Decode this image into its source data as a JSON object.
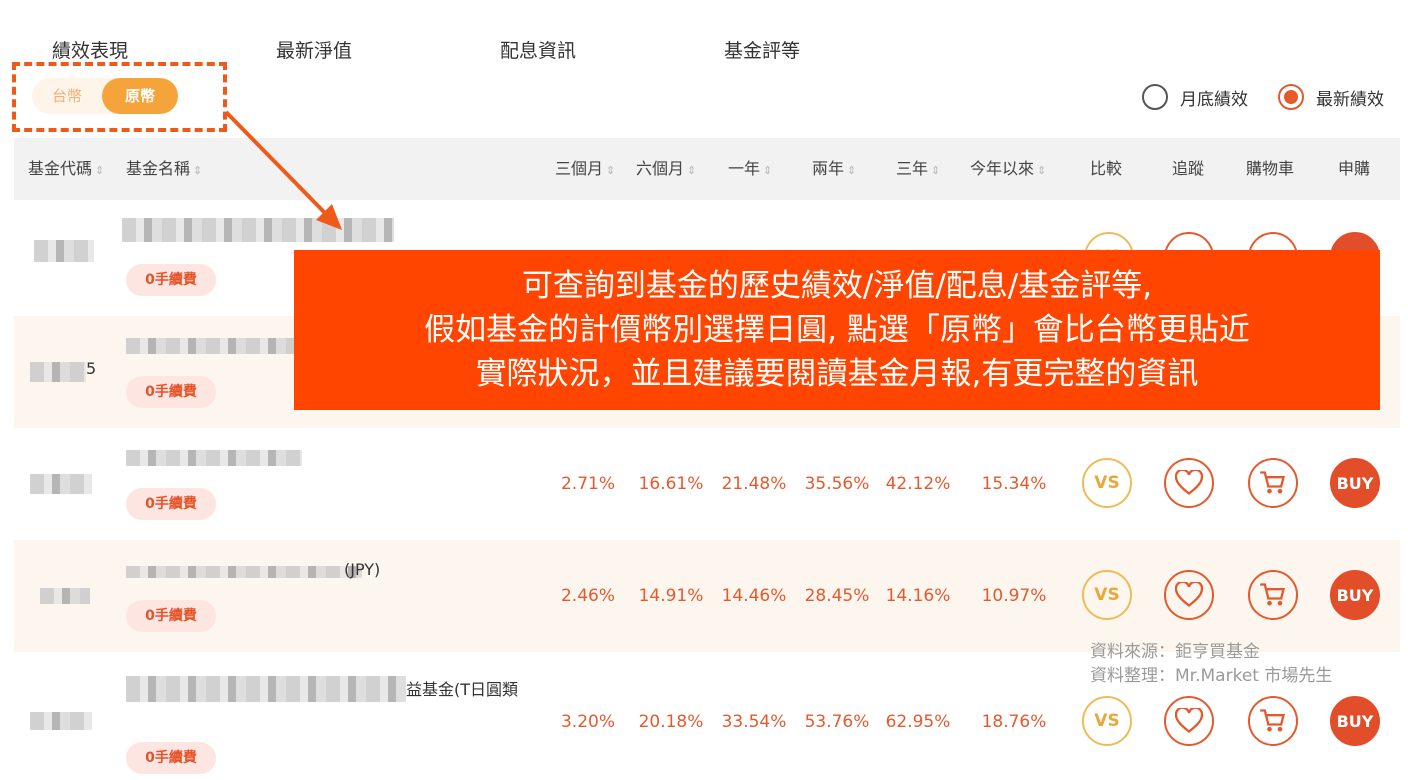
{
  "tabs": [
    "績效表現",
    "最新淨值",
    "配息資訊",
    "基金評等"
  ],
  "currency": {
    "twd": "台幣",
    "original": "原幣",
    "selected": "原幣"
  },
  "radios": {
    "month_end": "月底績效",
    "latest": "最新績效",
    "selected": "最新績效"
  },
  "table": {
    "headers": {
      "code": "基金代碼",
      "name": "基金名稱",
      "m3": "三個月",
      "m6": "六個月",
      "y1": "一年",
      "y2": "兩年",
      "y3": "三年",
      "ytd": "今年以來",
      "compare": "比較",
      "track": "追蹤",
      "cart": "購物車",
      "buy": "申購"
    },
    "rows": [
      {
        "code_tail": "",
        "name_visible": "",
        "fee": "0手續費",
        "m3": "",
        "m6": "",
        "y1": "",
        "y2": "",
        "y3": "",
        "ytd": ""
      },
      {
        "code_tail": "5",
        "name_visible": "",
        "fee": "0手續費",
        "m3": "",
        "m6": "",
        "y1": "",
        "y2": "",
        "y3": "",
        "ytd": ""
      },
      {
        "code_tail": "",
        "name_visible": "",
        "fee": "0手續費",
        "m3": "2.71%",
        "m6": "16.61%",
        "y1": "21.48%",
        "y2": "35.56%",
        "y3": "42.12%",
        "ytd": "15.34%"
      },
      {
        "code_tail": "",
        "name_visible": "(JPY)",
        "fee": "0手續費",
        "m3": "2.46%",
        "m6": "14.91%",
        "y1": "14.46%",
        "y2": "28.45%",
        "y3": "14.16%",
        "ytd": "10.97%"
      },
      {
        "code_tail": "",
        "name_visible": "益基金(T日圓類",
        "fee": "0手續費",
        "m3": "3.20%",
        "m6": "20.18%",
        "y1": "33.54%",
        "y2": "53.76%",
        "y3": "62.95%",
        "ytd": "18.76%"
      }
    ],
    "compare_label": "VS",
    "buy_label": "BUY"
  },
  "callout": {
    "line1": "可查詢到基金的歷史績效/淨值/配息/基金評等,",
    "line2": "假如基金的計價幣別選擇日圓, 點選「原幣」會比台幣更貼近",
    "line3": "實際狀況，並且建議要閱讀基金月報,有更完整的資訊"
  },
  "source": {
    "line1": "資料來源：鉅亨買基金",
    "line2": "資料整理：Mr.Market 市場先生"
  },
  "colors": {
    "accent": "#e45a2e",
    "callout_bg": "#ff4500",
    "toggle_active": "#f4a43b",
    "vs": "#e8a83c"
  }
}
